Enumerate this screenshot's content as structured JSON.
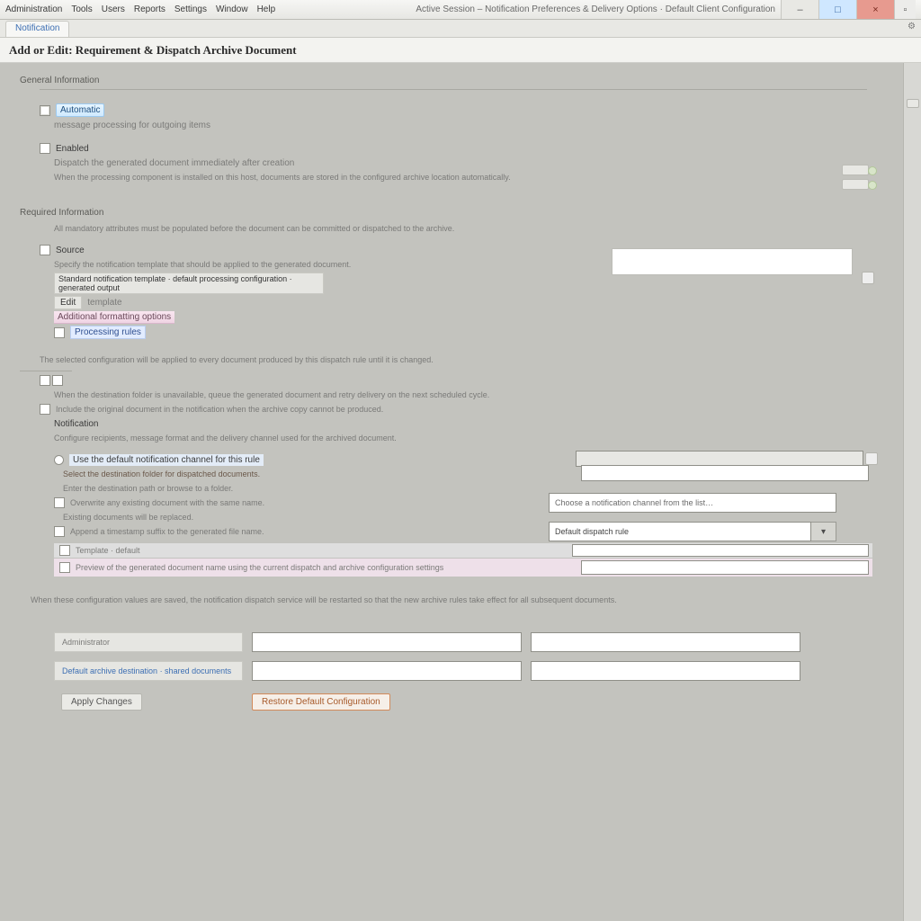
{
  "menubar": {
    "items": [
      "Administration",
      "Tools",
      "Users",
      "Reports",
      "Settings",
      "Window",
      "Help"
    ],
    "right_title": "Active Session – Notification Preferences & Delivery Options · Default Client Configuration"
  },
  "tab": {
    "label": "Notification"
  },
  "page": {
    "title": "Add or Edit: Requirement & Dispatch Archive Document"
  },
  "general": {
    "heading": "General Information",
    "auto_chip": "Automatic",
    "auto_rest": "message processing for outgoing items",
    "enabled_label": "Enabled",
    "enabled_desc": "Dispatch the generated document immediately after creation",
    "note_line": "When the processing component is installed on this host, documents are stored in the configured archive location automatically."
  },
  "required": {
    "heading": "Required Information",
    "row1": "All mandatory attributes must be populated before the document can be committed or dispatched to the archive.",
    "source_label": "Source",
    "source_desc": "Specify the notification template that should be applied to the generated document.",
    "template_chip": "Standard notification template · default processing configuration · generated output",
    "edit_prefix": "Edit",
    "edit_rest": "template",
    "pink_line": "Additional formatting options",
    "blue_line": "Processing rules",
    "summary_line": "The selected configuration will be applied to every document produced by this dispatch rule until it is changed."
  },
  "mid": {
    "row_a": "When the destination folder is unavailable, queue the generated document and retry delivery on the next scheduled cycle.",
    "row_b": "Include the original document in the notification when the archive copy cannot be produced.",
    "sub_heading": "Notification",
    "sub_desc": "Configure recipients, message format and the delivery channel used for the archived document.",
    "sub_item": "Use the default notification channel for this rule"
  },
  "inputs": {
    "path_field": "",
    "path_placeholder": "",
    "desc1": "Select the destination folder for dispatched documents.",
    "desc2": "Enter the destination path or browse to a folder.",
    "chk3": "Overwrite any existing document with the same name.",
    "desc3_sub": "Existing documents will be replaced.",
    "chk4": "Append a timestamp suffix to the generated file name.",
    "combo_placeholder": "Choose a notification channel from the list…",
    "combo2_value": "Default dispatch rule",
    "combo2_btn": "▾",
    "gray_tag": "Template · default",
    "pale_row_text": "Preview of the generated document name using the current dispatch and archive configuration settings"
  },
  "footer_note": "When these configuration values are saved, the notification dispatch service will be restarted so that the new archive rules take effect for all subsequent documents.",
  "bottom_grid": {
    "row1_label": "Administrator",
    "row2_label": "Default archive destination · shared documents",
    "action_gray": "Apply Changes",
    "action_orange": "Restore Default Configuration"
  },
  "buttons": {
    "min": "–",
    "max": "□",
    "close": "×",
    "aux": "▫"
  }
}
